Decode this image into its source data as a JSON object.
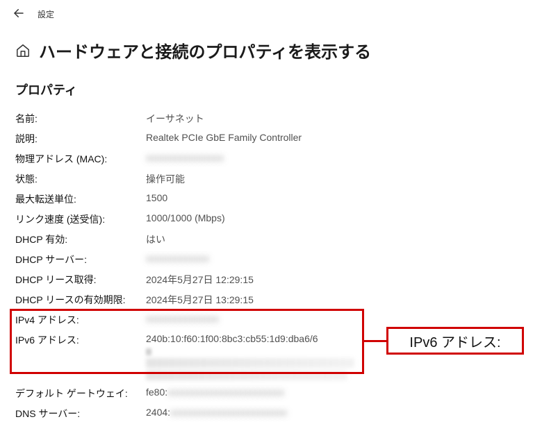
{
  "topbar": {
    "app_title": "設定"
  },
  "header": {
    "page_title": "ハードウェアと接続のプロパティを表示する"
  },
  "section_label": "プロパティ",
  "props": {
    "name_label": "名前:",
    "name_value": "イーサネット",
    "desc_label": "説明:",
    "desc_value": "Realtek PCIe GbE Family Controller",
    "mac_label": "物理アドレス (MAC):",
    "mac_value": "xxxxxxxxxxxxxxxx",
    "status_label": "状態:",
    "status_value": "操作可能",
    "mtu_label": "最大転送単位:",
    "mtu_value": "1500",
    "link_label": "リンク速度 (送受信):",
    "link_value": "1000/1000 (Mbps)",
    "dhcp_enabled_label": "DHCP 有効:",
    "dhcp_enabled_value": "はい",
    "dhcp_server_label": "DHCP サーバー:",
    "dhcp_server_value": "xxxxxxxxxxxxx",
    "dhcp_lease_label": "DHCP リース取得:",
    "dhcp_lease_value": "2024年5月27日 12:29:15",
    "dhcp_expiry_label": "DHCP リースの有効期限:",
    "dhcp_expiry_value": "2024年5月27日 13:29:15",
    "ipv4_label": "IPv4 アドレス:",
    "ipv4_value": "xxxxxxxxxxxxxxx",
    "ipv6_label": "IPv6 アドレス:",
    "ipv6_value": "240b:10:f60:1f00:8bc3:cb55:1d9:dba6/6",
    "gateway_label": "デフォルト ゲートウェイ:",
    "gateway_value_prefix": "fe80:",
    "gateway_value_rest": "xxxxxxxxxxxxxxxxxxxxxxxx",
    "dns_label": "DNS サーバー:",
    "dns_value_prefix": "2404:",
    "dns_value_rest": "xxxxxxxxxxxxxxxxxxxxxxxx"
  },
  "callout": {
    "label": "IPv6 アドレス:"
  }
}
